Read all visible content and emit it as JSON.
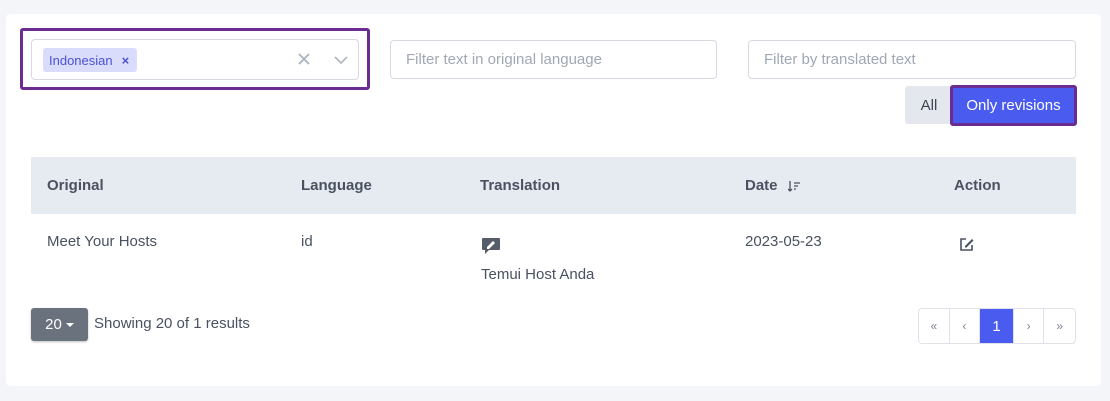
{
  "filters": {
    "language_tag": "Indonesian",
    "tag_remove": "×",
    "original_placeholder": "Filter text in original language",
    "translated_placeholder": "Filter by translated text"
  },
  "toggle": {
    "all_label": "All",
    "revisions_label": "Only revisions"
  },
  "table": {
    "headers": {
      "original": "Original",
      "language": "Language",
      "translation": "Translation",
      "date": "Date",
      "action": "Action"
    },
    "rows": [
      {
        "original": "Meet Your Hosts",
        "language": "id",
        "translation": "Temui Host Anda",
        "date": "2023-05-23"
      }
    ]
  },
  "footer": {
    "per_page": "20",
    "showing": "Showing 20 of 1 results"
  },
  "pagination": {
    "first": "«",
    "prev": "‹",
    "current": "1",
    "next": "›",
    "last": "»"
  },
  "colors": {
    "accent": "#4a5cf0",
    "highlight_outline": "#6b2c91",
    "tag_bg": "#dadcfb"
  },
  "icons": {
    "clear": "x-icon",
    "dropdown": "chevron-down-icon",
    "sort": "sort-descending-icon",
    "translation": "speech-bubble-edit-icon",
    "edit": "edit-icon"
  }
}
